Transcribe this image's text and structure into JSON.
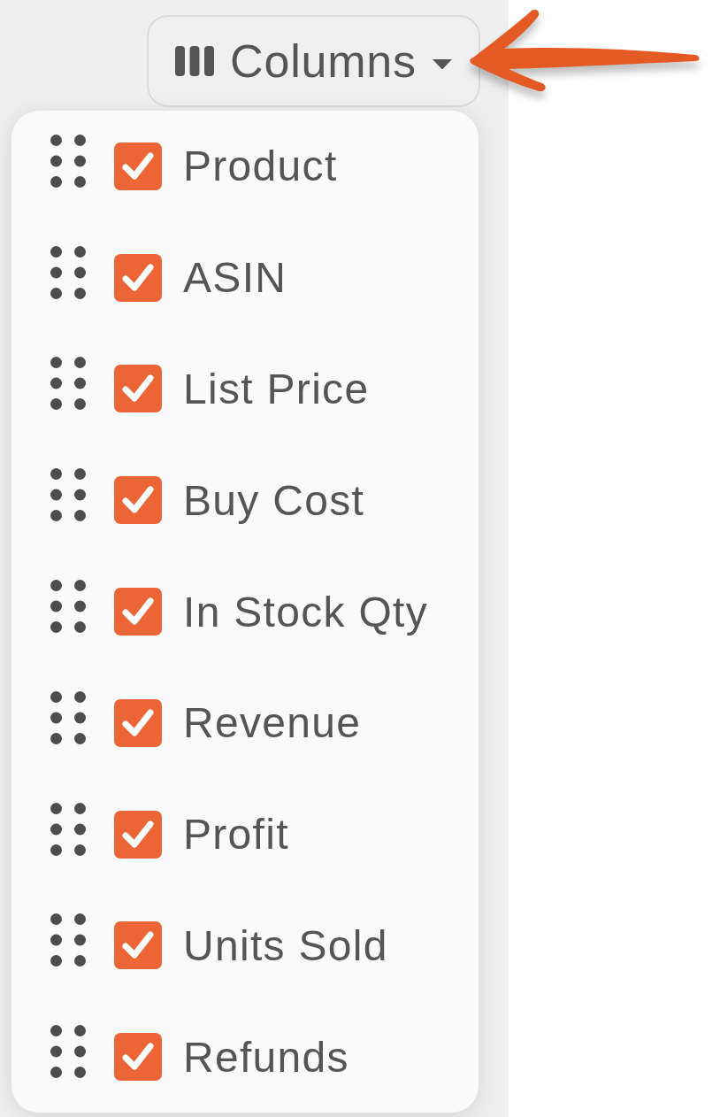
{
  "toolbar": {
    "columns_button": {
      "label": "Columns"
    }
  },
  "annotations": [
    {
      "kind": "arrow"
    }
  ],
  "column_menu": {
    "items": [
      {
        "label": "Product",
        "checked": true
      },
      {
        "label": "ASIN",
        "checked": true
      },
      {
        "label": "List Price",
        "checked": true
      },
      {
        "label": "Buy Cost",
        "checked": true
      },
      {
        "label": "In Stock Qty",
        "checked": true
      },
      {
        "label": "Revenue",
        "checked": true
      },
      {
        "label": "Profit",
        "checked": true
      },
      {
        "label": "Units Sold",
        "checked": true
      },
      {
        "label": "Refunds",
        "checked": true
      }
    ]
  }
}
